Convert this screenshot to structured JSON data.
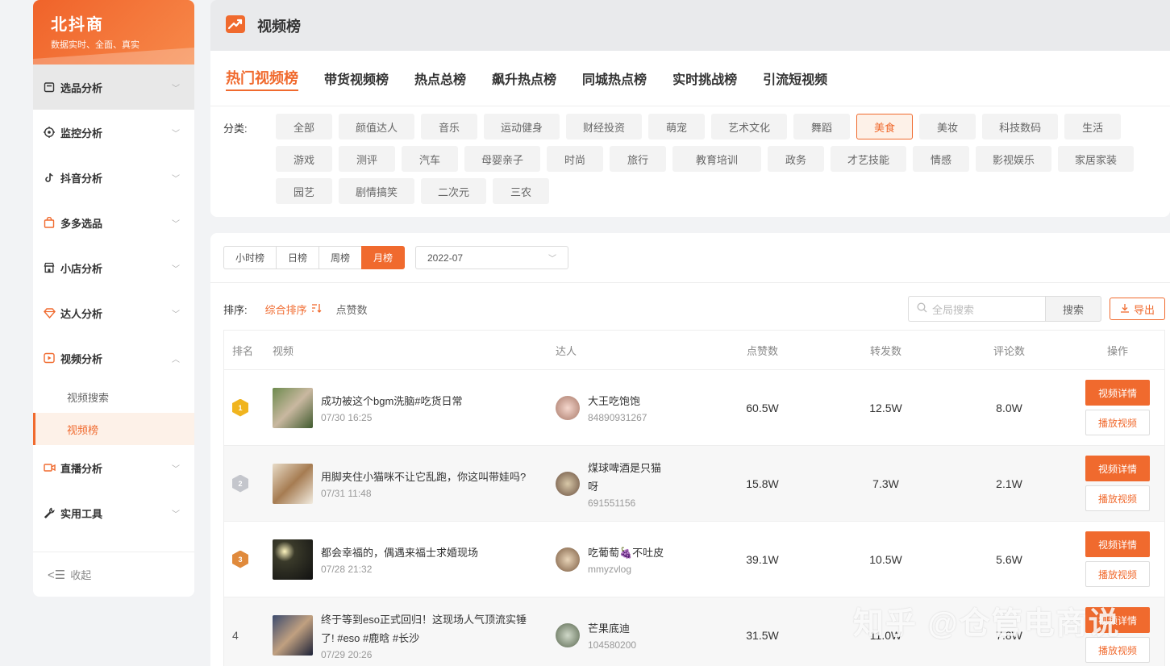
{
  "brand": {
    "name": "北抖商",
    "tagline": "数据实时、全面、真实"
  },
  "sidebar": {
    "items": [
      {
        "label": "选品分析",
        "icon": "calendar-icon"
      },
      {
        "label": "监控分析",
        "icon": "target-icon"
      },
      {
        "label": "抖音分析",
        "icon": "tiktok-icon"
      },
      {
        "label": "多多选品",
        "icon": "bag-icon"
      },
      {
        "label": "小店分析",
        "icon": "store-icon"
      },
      {
        "label": "达人分析",
        "icon": "diamond-icon"
      },
      {
        "label": "视频分析",
        "icon": "video-icon"
      },
      {
        "label": "直播分析",
        "icon": "camera-icon"
      },
      {
        "label": "实用工具",
        "icon": "wrench-icon"
      }
    ],
    "sub_items": [
      "视频搜索",
      "视频榜"
    ],
    "collapse_label": "收起"
  },
  "header": {
    "title": "视频榜"
  },
  "tabs": [
    "热门视频榜",
    "带货视频榜",
    "热点总榜",
    "飙升热点榜",
    "同城热点榜",
    "实时挑战榜",
    "引流短视频"
  ],
  "categories": {
    "label": "分类:",
    "items": [
      "全部",
      "颜值达人",
      "音乐",
      "运动健身",
      "财经投资",
      "萌宠",
      "艺术文化",
      "舞蹈",
      "美食",
      "美妆",
      "科技数码",
      "生活",
      "游戏",
      "测评",
      "汽车",
      "母婴亲子",
      "时尚",
      "旅行",
      "教育培训",
      "政务",
      "才艺技能",
      "情感",
      "影视娱乐",
      "家居家装",
      "园艺",
      "剧情搞笑",
      "二次元",
      "三农"
    ],
    "selected": "美食"
  },
  "periods": [
    "小时榜",
    "日榜",
    "周榜",
    "月榜"
  ],
  "selected_period": "月榜",
  "month": "2022-07",
  "sort": {
    "label": "排序:",
    "options": [
      "综合排序",
      "点赞数"
    ],
    "selected": "综合排序"
  },
  "search": {
    "placeholder": "全局搜索",
    "button": "搜索"
  },
  "export_label": "导出",
  "table": {
    "headers": [
      "排名",
      "视频",
      "达人",
      "点赞数",
      "转发数",
      "评论数",
      "操作"
    ],
    "rows": [
      {
        "rank": "1",
        "title": "成功被这个bgm洗脑#吃货日常",
        "time": "07/30 16:25",
        "author": "大王吃饱饱",
        "author_id": "84890931267",
        "likes": "60.5W",
        "shares": "12.5W",
        "comments": "8.0W"
      },
      {
        "rank": "2",
        "title": "用脚夹住小猫咪不让它乱跑，你这叫带娃吗?",
        "time": "07/31 11:48",
        "author": "煤球啤酒是只猫呀",
        "author_id": "691551156",
        "likes": "15.8W",
        "shares": "7.3W",
        "comments": "2.1W"
      },
      {
        "rank": "3",
        "title": "都会幸福的，偶遇来福士求婚现场",
        "time": "07/28 21:32",
        "author": "吃葡萄🍇不吐皮",
        "author_id": "mmyzvlog",
        "likes": "39.1W",
        "shares": "10.5W",
        "comments": "5.6W"
      },
      {
        "rank": "4",
        "title": "终于等到eso正式回归！这现场人气顶流实锤了! #eso #鹿晗 #长沙",
        "time": "07/29 20:26",
        "author": "芒果底迪",
        "author_id": "104580200",
        "likes": "31.5W",
        "shares": "11.0W",
        "comments": "7.8W"
      }
    ],
    "detail_label": "视频详情",
    "play_label": "播放视频"
  },
  "watermark": "知乎 @仓管电商说",
  "colors": {
    "accent": "#f06a2e",
    "gold": "#f0b41e",
    "silver": "#c4c6cc",
    "bronze": "#e08a3c"
  }
}
